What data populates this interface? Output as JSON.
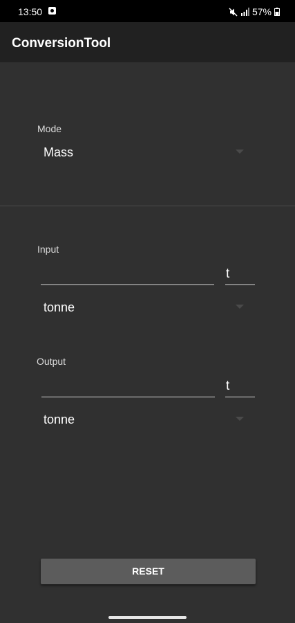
{
  "status_bar": {
    "time": "13:50",
    "battery": "57%",
    "icons": [
      "notification-icon",
      "mute-icon",
      "signal-icon",
      "battery-icon"
    ]
  },
  "app_bar": {
    "title": "ConversionTool"
  },
  "mode": {
    "label": "Mode",
    "selected": "Mass"
  },
  "input": {
    "label": "Input",
    "value": "",
    "unit_symbol": "t",
    "selected_unit": "tonne"
  },
  "output": {
    "label": "Output",
    "value": "",
    "unit_symbol": "t",
    "selected_unit": "tonne"
  },
  "reset_button": {
    "label": "RESET"
  },
  "colors": {
    "background": "#303030",
    "app_bar": "#212121",
    "button": "#5c5c5c"
  }
}
